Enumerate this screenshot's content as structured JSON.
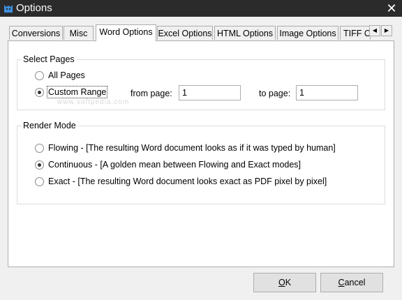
{
  "window": {
    "title": "Options",
    "icon": "cat-app-icon",
    "close_glyph": "✕"
  },
  "tabs": [
    "Conversions",
    "Misc",
    "Word Options",
    "Excel Options",
    "HTML Options",
    "Image Options",
    "TIFF O"
  ],
  "active_tab": "Word Options",
  "tab_scroll": {
    "left": "◀",
    "right": "▶"
  },
  "select_pages": {
    "legend": "Select Pages",
    "all_pages": "All Pages",
    "custom_range": "Custom Range",
    "selected": "custom_range",
    "from_label": "from page:",
    "from_value": "1",
    "to_label": "to page:",
    "to_value": "1"
  },
  "render_mode": {
    "legend": "Render Mode",
    "options": [
      "Flowing - [The resulting Word document looks as if it was typed by human]",
      "Continuous - [A golden mean between Flowing and Exact modes]",
      "Exact - [The resulting Word document looks exact as PDF pixel by pixel]"
    ],
    "selected_index": 1
  },
  "watermark": "www.softpedia.com",
  "buttons": {
    "ok_mn": "O",
    "ok_rest": "K",
    "cancel_mn": "C",
    "cancel_rest": "ancel"
  }
}
